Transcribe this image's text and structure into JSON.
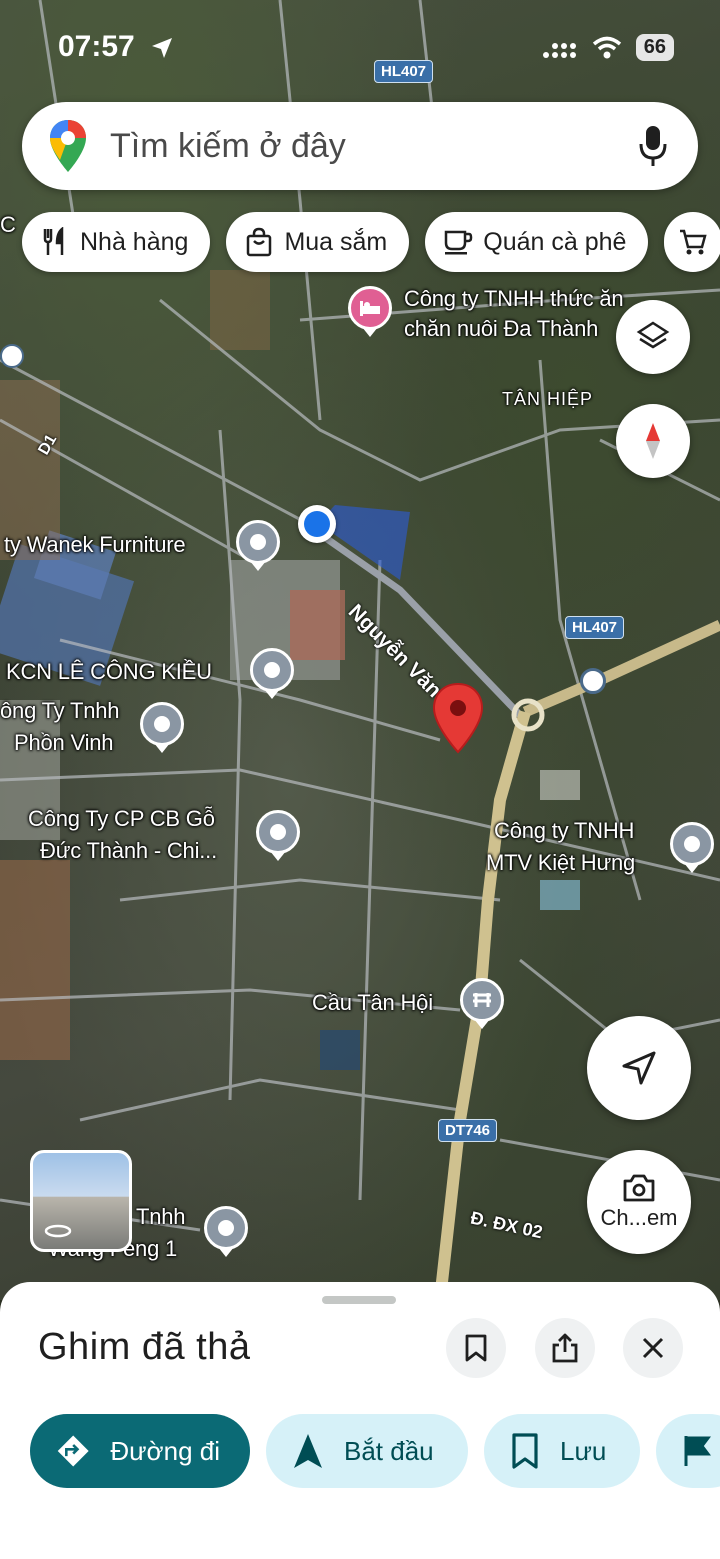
{
  "status_bar": {
    "time": "07:57",
    "battery": "66",
    "icons": [
      "location-arrow-icon",
      "cellular-icon",
      "wifi-icon",
      "battery-icon"
    ]
  },
  "search": {
    "placeholder": "Tìm kiếm ở đây",
    "icons": [
      "google-maps-logo",
      "mic-icon"
    ]
  },
  "chips": [
    {
      "label": "Nhà hàng",
      "icon": "fork-knife-icon"
    },
    {
      "label": "Mua sắm",
      "icon": "shopping-bag-icon"
    },
    {
      "label": "Quán cà phê",
      "icon": "coffee-cup-icon"
    }
  ],
  "map": {
    "labels": {
      "poi_hotel_1": "Công ty TNHH thức ăn",
      "poi_hotel_2": "chăn nuôi Đa Thành",
      "area_tan_hiep": "TÂN HIỆP",
      "poi_wanek": "ty Wanek Furniture",
      "poi_kcn": "KCN LÊ CÔNG KIỀU",
      "poi_phon_vinh_1": "ông Ty Tnhh",
      "poi_phon_vinh_2": "Phồn Vinh",
      "poi_cp_go_1": "Công Ty CP CB Gỗ",
      "poi_cp_go_2": "Đức Thành - Chi...",
      "poi_kiet_hung_1": "Công ty TNHH",
      "poi_kiet_hung_2": "MTV Kiệt Hưng",
      "poi_cau_tan_hoi": "Cầu Tân Hội",
      "poi_wang_1": "Tnhh",
      "poi_wang_2": "Wang Feng 1",
      "edge_c": "C"
    },
    "roads": {
      "nguyen_van_linh": "Nguyễn Văn Linh",
      "d1": "D1",
      "dx02": "Đ. ĐX 02",
      "hl407_top": "HL407",
      "hl407_mid": "HL407",
      "dt746": "DT746"
    }
  },
  "controls": {
    "layers": "layers-icon",
    "compass": "compass-icon",
    "location": "navigation-arrow-icon",
    "camera_label": "Ch...em"
  },
  "sheet": {
    "title": "Ghim đã thả",
    "actions": [
      {
        "label": "Đường đi",
        "icon": "directions-icon"
      },
      {
        "label": "Bắt đầu",
        "icon": "navigate-icon"
      },
      {
        "label": "Lưu",
        "icon": "bookmark-icon"
      },
      {
        "label": "",
        "icon": "flag-icon"
      }
    ]
  },
  "colors": {
    "primary_action": "#0b6a75",
    "tonal_action": "#d6f1f8",
    "pin_red": "#e53935",
    "my_location": "#1a73e8"
  }
}
